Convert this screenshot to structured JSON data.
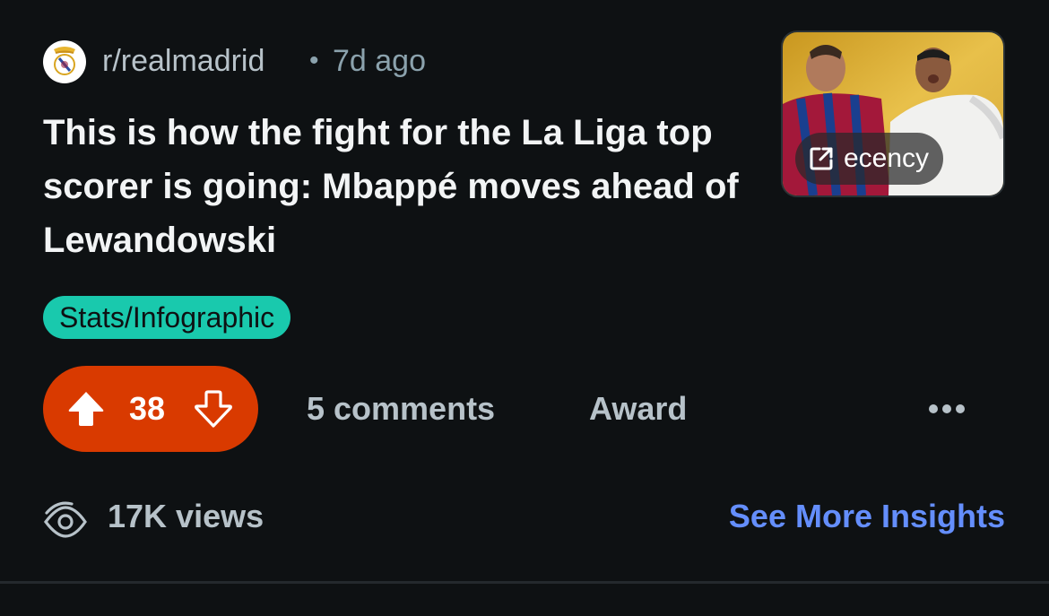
{
  "post": {
    "subreddit": "r/realmadrid",
    "separator": "•",
    "time_ago": "7d ago",
    "title": "This is how the fight for the La Liga top scorer is going: Mbappé moves ahead of Lewandowski",
    "thumbnail": {
      "link_domain": "ecency",
      "link_icon": "external-link-icon"
    },
    "flair": {
      "label": "Stats/Infographic",
      "color": "#19c9ad"
    }
  },
  "actions": {
    "vote_count": "38",
    "vote_color": "#d93a00",
    "comments_label": "5 comments",
    "award_label": "Award",
    "more_icon": "more-options-icon"
  },
  "insights": {
    "views_label": "17K views",
    "link_label": "See More Insights",
    "link_color": "#648efc"
  }
}
